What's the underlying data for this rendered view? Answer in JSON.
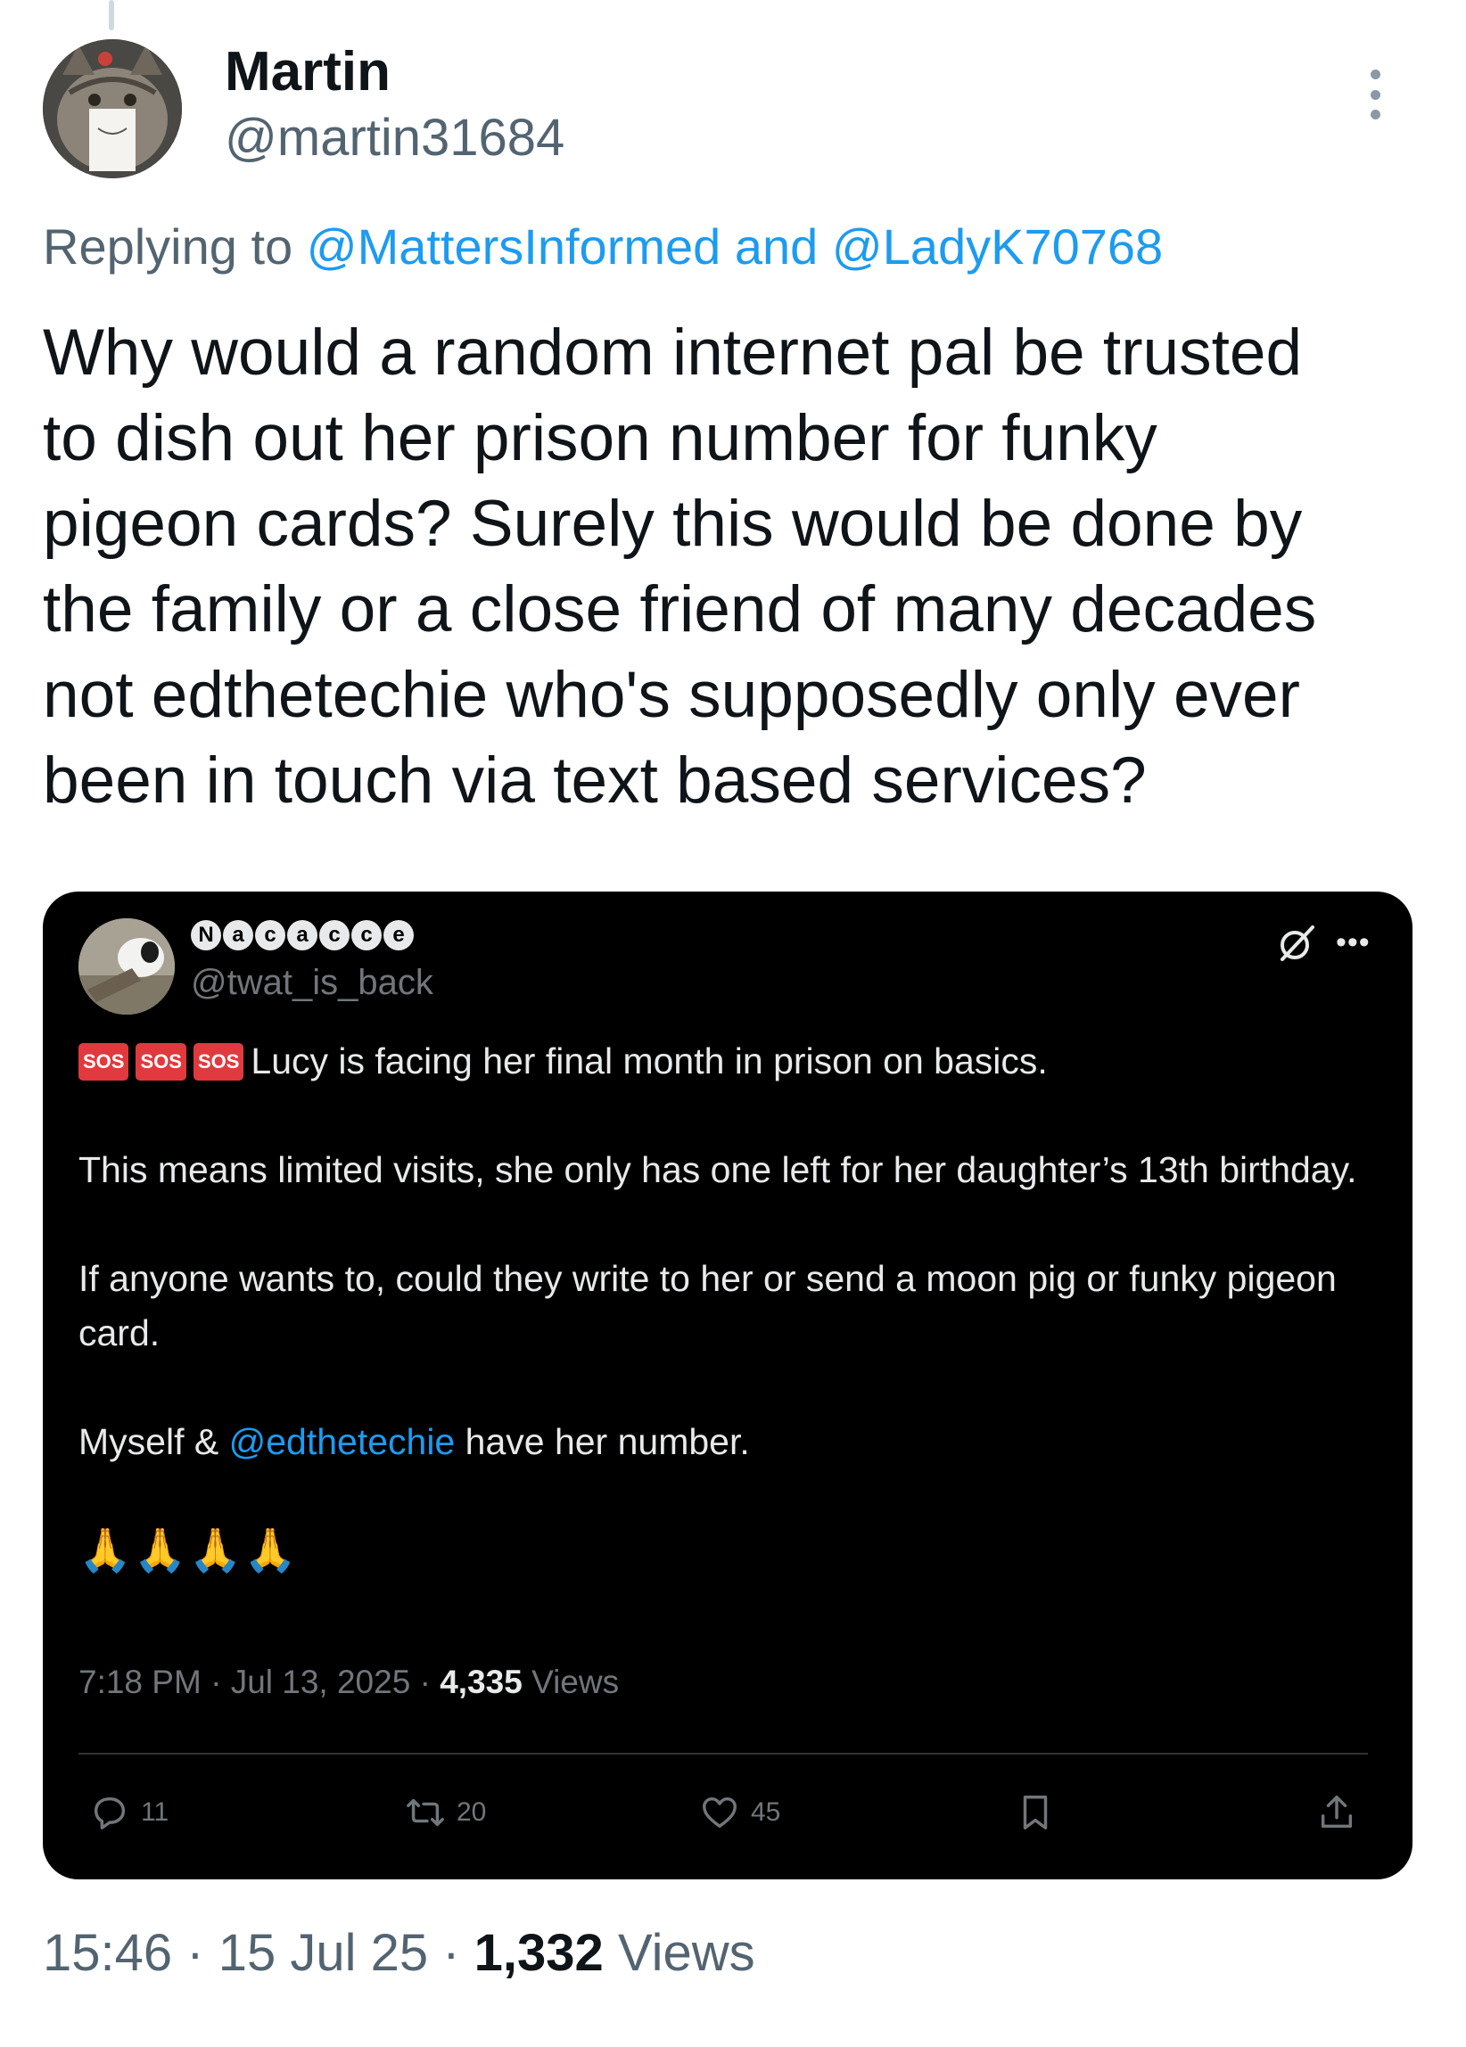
{
  "author": {
    "name": "Martin",
    "handle": "@martin31684"
  },
  "reply": {
    "prefix": "Replying to",
    "mention_1": "@MattersInformed",
    "conjunction": "and",
    "mention_2": "@LadyK70768"
  },
  "tweet": {
    "text": "Why would a random internet pal be trusted\nto dish out her prison number for funky\npigeon cards? Surely this would be done by\nthe family or a close friend of many decades\nnot edthetechie who's supposedly only ever\nbeen in touch via text based services?",
    "time": "15:46",
    "date": "15 Jul 25",
    "views_count": "1,332",
    "views_label": "Views"
  },
  "quote": {
    "name_letters": [
      "N",
      "a",
      "c",
      "a",
      "c",
      "c",
      "e"
    ],
    "handle": "@twat_is_back",
    "sos_label": "SOS",
    "line_1": "Lucy is facing her final month in prison on basics.",
    "paragraph_2": "This means limited visits, she only has one left for her daughter’s 13th birthday.",
    "paragraph_3": "If anyone wants to, could they write to her or send a moon pig or funky pigeon card.",
    "p4_prefix": "Myself &",
    "p4_mention": "@edthetechie",
    "p4_suffix": "have her number.",
    "emoji": "🙏🙏🙏🙏",
    "time": "7:18 PM",
    "date": "Jul 13, 2025",
    "views_count": "4,335",
    "views_label": "Views",
    "replies": "11",
    "reposts": "20",
    "likes": "45"
  },
  "colors": {
    "link": "#1d9bf0",
    "quote_bg": "#000000",
    "muted": "#536471",
    "sos_red": "#e03a3e"
  },
  "icons": {
    "more": "more-vertical-icon",
    "grok": "grok-icon",
    "reply": "reply-icon",
    "repost": "repost-icon",
    "like": "heart-icon",
    "bookmark": "bookmark-icon",
    "share": "share-icon"
  }
}
